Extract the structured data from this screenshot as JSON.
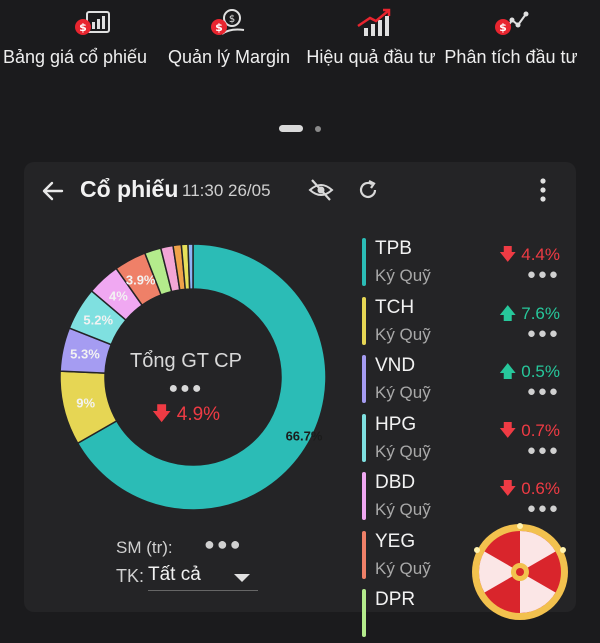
{
  "menu": {
    "items": [
      {
        "label": "Bảng giá cổ phiếu",
        "icon": "price-board-icon"
      },
      {
        "label": "Quản lý Margin",
        "icon": "margin-money-icon"
      },
      {
        "label": "Hiệu quả đầu tư",
        "icon": "investment-growth-icon"
      },
      {
        "label": "Phân tích đầu tư",
        "icon": "investment-analysis-icon"
      }
    ]
  },
  "card": {
    "title": "Cổ phiếu",
    "subtitle": "11:30 26/05",
    "donut": {
      "center_label": "Tổng GT CP",
      "center_value": "●●●",
      "center_change": "4.9%",
      "center_change_direction": "down"
    },
    "sm_label": "SM (tr):",
    "sm_value": "●●●",
    "tk_label": "TK:",
    "tk_value": "Tất cả"
  },
  "chart_data": {
    "type": "pie",
    "title": "",
    "slices": [
      {
        "label": "66.7%",
        "value": 66.7,
        "color": "#2bbcb6"
      },
      {
        "label": "9%",
        "value": 9.0,
        "color": "#e6d654"
      },
      {
        "label": "5.3%",
        "value": 5.3,
        "color": "#a59cf2"
      },
      {
        "label": "5.2%",
        "value": 5.2,
        "color": "#7fe0e0"
      },
      {
        "label": "4%",
        "value": 4.0,
        "color": "#f0a8f2"
      },
      {
        "label": "3.9%",
        "value": 3.9,
        "color": "#ef8068"
      },
      {
        "label": "",
        "value": 2.0,
        "color": "#b4eb8c"
      },
      {
        "label": "",
        "value": 1.5,
        "color": "#f2a6d6"
      },
      {
        "label": "",
        "value": 1.0,
        "color": "#f0a24a"
      },
      {
        "label": "",
        "value": 0.8,
        "color": "#e7e05a"
      },
      {
        "label": "",
        "value": 0.6,
        "color": "#8fb4f5"
      }
    ]
  },
  "stocks": [
    {
      "code": "TPB",
      "type": "Ký Quỹ",
      "change": "4.4%",
      "direction": "down",
      "value": "●●●",
      "color": "#2bbcb6"
    },
    {
      "code": "TCH",
      "type": "Ký Quỹ",
      "change": "7.6%",
      "direction": "up",
      "value": "●●●",
      "color": "#e6d654"
    },
    {
      "code": "VND",
      "type": "Ký Quỹ",
      "change": "0.5%",
      "direction": "up",
      "value": "●●●",
      "color": "#a59cf2"
    },
    {
      "code": "HPG",
      "type": "Ký Quỹ",
      "change": "0.7%",
      "direction": "down",
      "value": "●●●",
      "color": "#7fe0e0"
    },
    {
      "code": "DBD",
      "type": "Ký Quỹ",
      "change": "0.6%",
      "direction": "down",
      "value": "●●●",
      "color": "#f0a8f2"
    },
    {
      "code": "YEG",
      "type": "Ký Quỹ",
      "change": "",
      "direction": "",
      "value": "",
      "color": "#ef8068"
    },
    {
      "code": "DPR",
      "type": "",
      "change": "",
      "direction": "",
      "value": "",
      "color": "#b4eb8c"
    }
  ],
  "colors": {
    "up": "#27c79b",
    "down": "#ef3b44",
    "accent_red": "#e8252f"
  }
}
